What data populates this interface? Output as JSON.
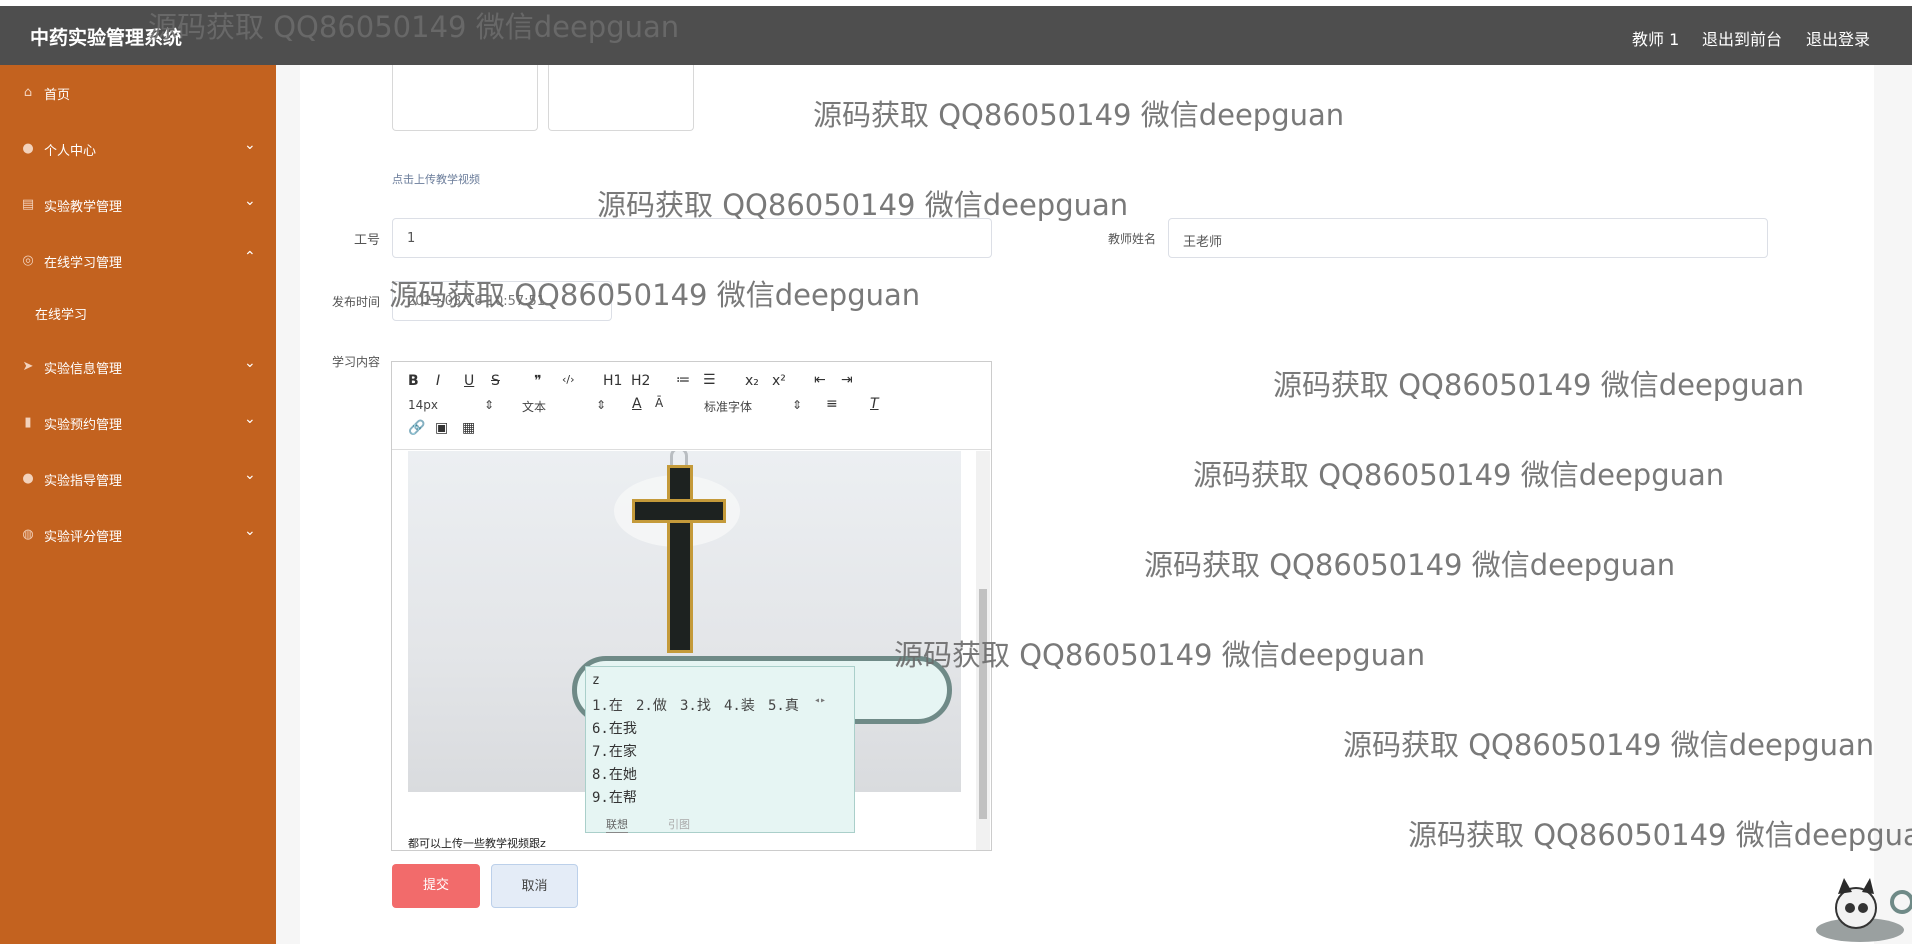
{
  "header": {
    "app_title": "中药实验管理系统",
    "user_label": "教师 1",
    "exit_frontend": "退出到前台",
    "logout": "退出登录"
  },
  "sidebar": {
    "items": [
      {
        "label": "首页",
        "icon": "home-icon"
      },
      {
        "label": "个人中心",
        "icon": "user-icon"
      },
      {
        "label": "实验教学管理",
        "icon": "clipboard-icon"
      },
      {
        "label": "在线学习管理",
        "icon": "globe-icon"
      },
      {
        "label": "在线学习",
        "icon": ""
      },
      {
        "label": "实验信息管理",
        "icon": "send-icon"
      },
      {
        "label": "实验预约管理",
        "icon": "bar-chart-icon"
      },
      {
        "label": "实验指导管理",
        "icon": "user-icon"
      },
      {
        "label": "实验评分管理",
        "icon": "palette-icon"
      }
    ]
  },
  "form": {
    "upload_hint": "点击上传教学视频",
    "job_no_label": "工号",
    "job_no_value": "1",
    "teacher_name_label": "教师姓名",
    "teacher_name_value": "王老师",
    "publish_time_label": "发布时间",
    "publish_time_value": "2023-03-16 10:57:51",
    "content_label": "学习内容",
    "submit_label": "提交",
    "cancel_label": "取消"
  },
  "editor": {
    "toolbar_row1": [
      "B",
      "I",
      "U",
      "S",
      "❞",
      "‹/›",
      "H1",
      "H2",
      "≔",
      "☰",
      "x₂",
      "x²",
      "⇤",
      "⇥"
    ],
    "font_size": "14px",
    "block_type": "文本",
    "font_family": "标准字体",
    "content_text": "都可以上传一些教学视频跟z"
  },
  "ime": {
    "composition": "z",
    "candidates_row1": [
      "1.在",
      "2.做",
      "3.找",
      "4.装",
      "5.真"
    ],
    "candidates_list": [
      "6.在我",
      "7.在家",
      "8.在她",
      "9.在帮"
    ],
    "footer_left": "联想",
    "footer_right": "引图"
  },
  "watermark": "源码获取 QQ86050149 微信deepguan"
}
